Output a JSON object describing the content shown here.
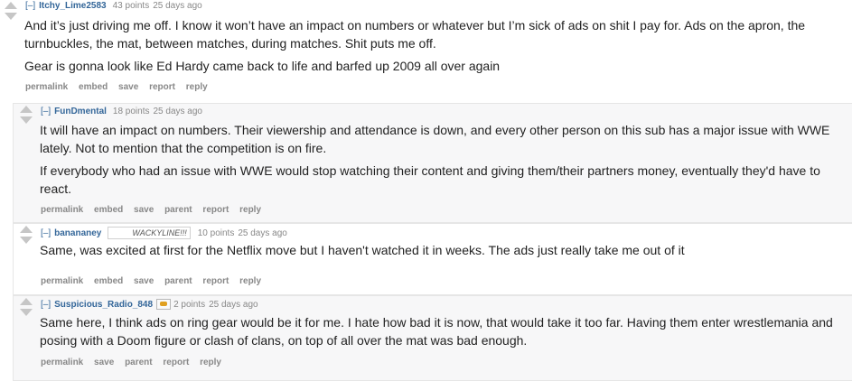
{
  "actions": {
    "permalink": "permalink",
    "embed": "embed",
    "save": "save",
    "report": "report",
    "reply": "reply",
    "parent": "parent"
  },
  "comments": [
    {
      "expand": "[–]",
      "author": "Itchy_Lime2583",
      "score": "43 points",
      "time": "25 days ago",
      "paragraphs": [
        "And it’s just driving me off. I know it won’t have an impact on numbers or whatever but I’m sick of ads on shit I pay for. Ads on the apron, the turnbuckles, the mat, between matches, during matches. Shit puts me off.",
        "Gear is gonna look like Ed Hardy came back to life and barfed up 2009 all over again"
      ]
    },
    {
      "expand": "[–]",
      "author": "FunDmental",
      "score": "18 points",
      "time": "25 days ago",
      "paragraphs": [
        "It will have an impact on numbers. Their viewership and attendance is down, and every other person on this sub has a major issue with WWE lately. Not to mention that the competition is on fire.",
        "If everybody who had an issue with WWE would stop watching their content and giving them/their partners money, eventually they'd have to react."
      ]
    },
    {
      "expand": "[–]",
      "author": "banananey",
      "flair": "WACKYLINE!!!",
      "score": "10 points",
      "time": "25 days ago",
      "paragraphs": [
        "Same, was excited at first for the Netflix move but I haven't watched it in weeks. The ads just really take me out of it"
      ]
    },
    {
      "expand": "[–]",
      "author": "Suspicious_Radio_848",
      "flair_icon": "wrestling-belt-icon",
      "score": "2 points",
      "time": "25 days ago",
      "paragraphs": [
        "Same here, I think ads on ring gear would be it for me. I hate how bad it is now, that would take it too far. Having them enter wrestlemania and posing with a Doom figure or clash of clans, on top of all over the mat was bad enough."
      ]
    }
  ]
}
